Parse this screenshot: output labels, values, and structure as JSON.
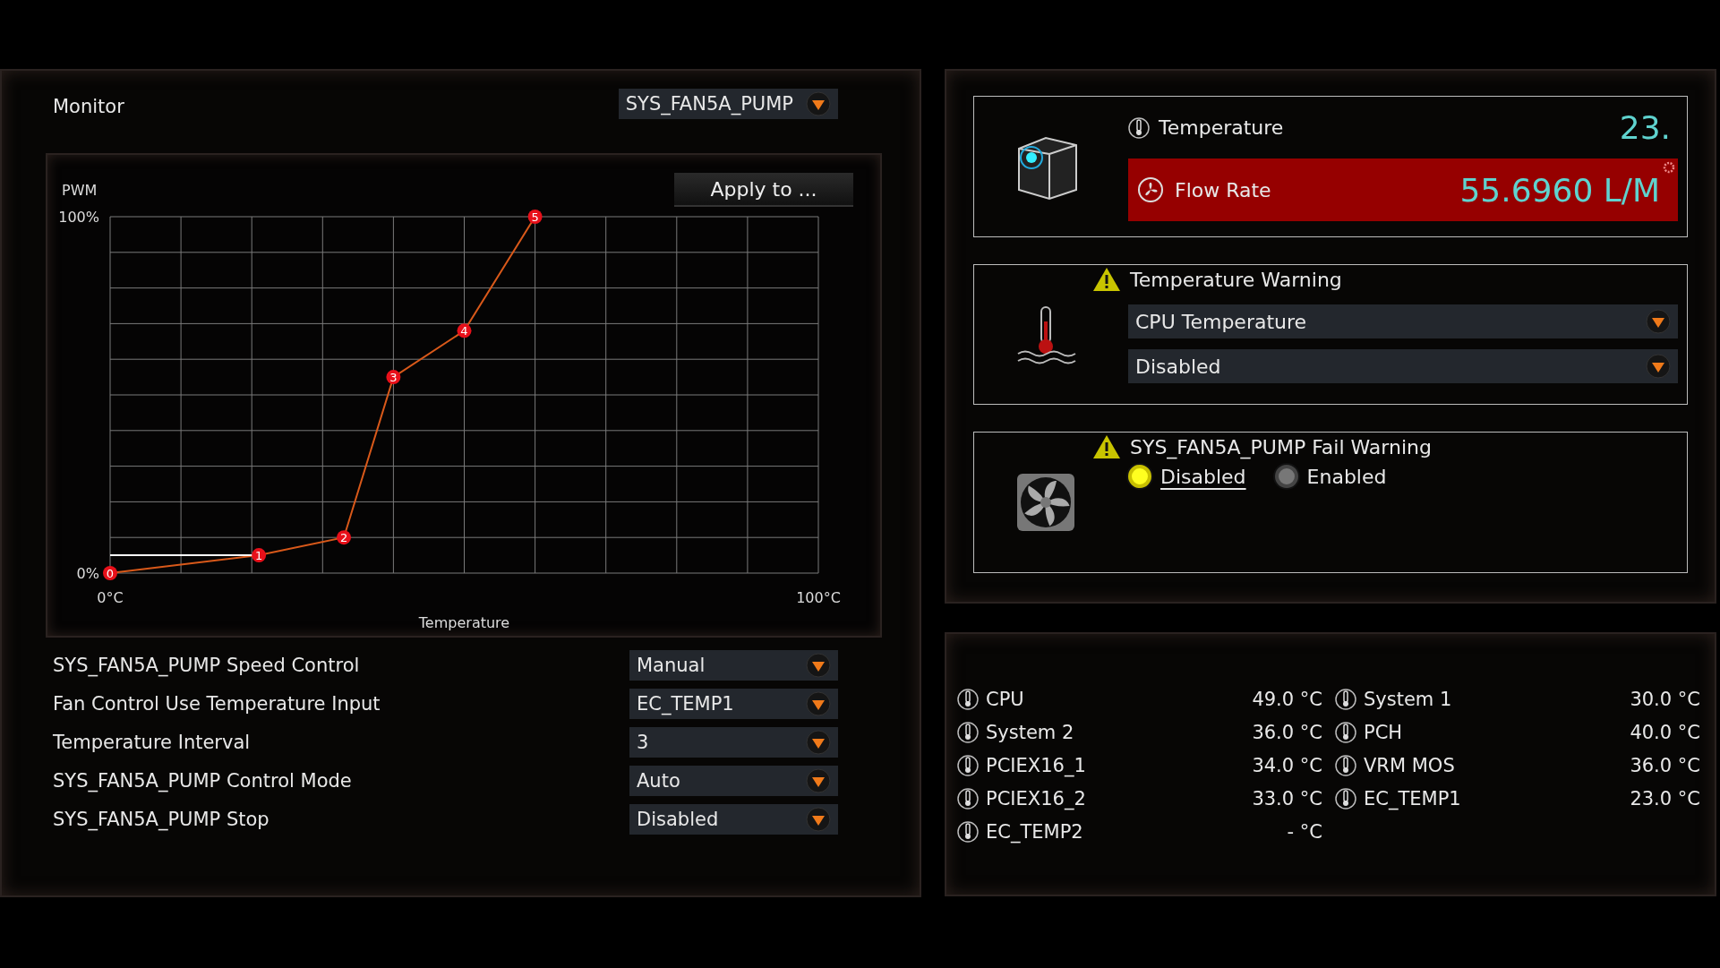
{
  "monitor": {
    "title": "Monitor",
    "fan_select": "SYS_FAN5A_PUMP"
  },
  "curve": {
    "apply_button": "Apply to ...",
    "chart_data": {
      "type": "line",
      "xlabel": "Temperature",
      "ylabel": "PWM",
      "x": [
        0,
        21,
        33,
        40,
        50,
        60
      ],
      "series": [
        {
          "color": "#d9591a",
          "marker": "circle",
          "values": [
            0,
            5,
            10,
            55,
            68,
            100
          ]
        }
      ],
      "xlim": [
        0,
        100
      ],
      "ylim": [
        0,
        100
      ],
      "xticks": [
        {
          "value": 0,
          "label": "0°C"
        },
        {
          "value": 100,
          "label": "100°C"
        }
      ],
      "yticks": [
        {
          "value": 0,
          "label": "0%"
        },
        {
          "value": 100,
          "label": "100%"
        }
      ],
      "annotations": [
        "0",
        "1",
        "2",
        "3",
        "4",
        "5"
      ]
    }
  },
  "settings": [
    {
      "label": "SYS_FAN5A_PUMP Speed Control",
      "value": "Manual"
    },
    {
      "label": "Fan Control Use Temperature Input",
      "value": "EC_TEMP1"
    },
    {
      "label": "Temperature Interval",
      "value": "3"
    },
    {
      "label": "SYS_FAN5A_PUMP Control Mode",
      "value": "Auto"
    },
    {
      "label": "SYS_FAN5A_PUMP Stop",
      "value": "Disabled"
    }
  ],
  "sensor_card": {
    "temperature_label": "Temperature",
    "temperature_value": "23.",
    "flow_label": "Flow Rate",
    "flow_value": "55.6960 L/M"
  },
  "temperature_warning": {
    "title": "Temperature Warning",
    "source": "CPU Temperature",
    "setting": "Disabled"
  },
  "fail_warning": {
    "title": "SYS_FAN5A_PUMP Fail Warning",
    "options": [
      {
        "label": "Disabled",
        "selected": true
      },
      {
        "label": "Enabled",
        "selected": false
      }
    ]
  },
  "sensors": [
    {
      "name": "CPU",
      "value": "49.0 °C"
    },
    {
      "name": "System 1",
      "value": "30.0 °C"
    },
    {
      "name": "System 2",
      "value": "36.0 °C"
    },
    {
      "name": "PCH",
      "value": "40.0 °C"
    },
    {
      "name": "PCIEX16_1",
      "value": "34.0 °C"
    },
    {
      "name": "VRM MOS",
      "value": "36.0 °C"
    },
    {
      "name": "PCIEX16_2",
      "value": "33.0 °C"
    },
    {
      "name": "EC_TEMP1",
      "value": "23.0 °C"
    },
    {
      "name": "EC_TEMP2",
      "value": "- °C"
    }
  ]
}
